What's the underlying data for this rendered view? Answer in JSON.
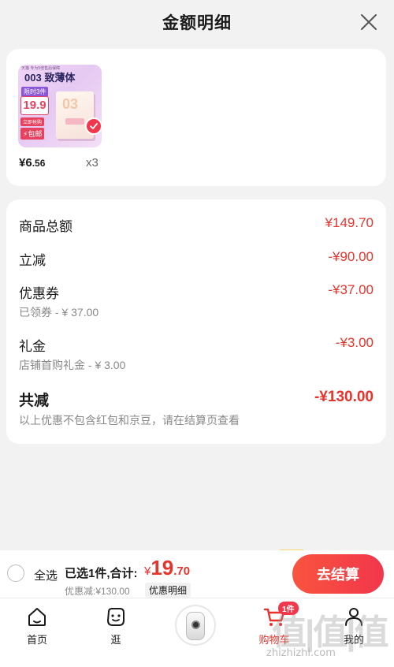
{
  "header": {
    "title": "金额明细"
  },
  "product": {
    "thumb_code": "003",
    "thumb_title": "致薄体",
    "thumb_topline": "天猫 专为5倍售后保障",
    "thumb_limit": "限时3件",
    "thumb_price": "19.9",
    "thumb_small": "立即抢购",
    "thumb_post": "⚡包邮",
    "price_symbol": "¥",
    "price_int": "6",
    "price_dec": ".56",
    "qty": "x3"
  },
  "details": {
    "goods_total_label": "商品总额",
    "goods_total_value": "¥149.70",
    "instant_label": "立减",
    "instant_value": "-¥90.00",
    "coupon_label": "优惠券",
    "coupon_value": "-¥37.00",
    "coupon_sub": "已领券 - ¥ 37.00",
    "gift_label": "礼金",
    "gift_value": "-¥3.00",
    "gift_sub": "店铺首购礼金 - ¥ 3.00",
    "total_label": "共减",
    "total_value": "-¥130.00",
    "note": "以上优惠不包含红包和京豆，请在结算页查看"
  },
  "bottom_bar": {
    "select_all": "全选",
    "selected_text": "已选1件,合计:",
    "total_symbol": "¥",
    "total_int": "19",
    "total_dec": ".70",
    "discount_text": "优惠减:¥130.00",
    "detail_link": "优惠明细",
    "checkout": "去结算"
  },
  "tabbar": {
    "home": "首页",
    "browse": "逛",
    "cart": "购物车",
    "mine": "我的",
    "cart_badge": "1件"
  },
  "watermark": {
    "text": "值|值|值",
    "url": "zhizhizhi.com"
  },
  "colors": {
    "accent": "#e8322a",
    "button": "#f2364b",
    "background": "#f2f2f2"
  }
}
